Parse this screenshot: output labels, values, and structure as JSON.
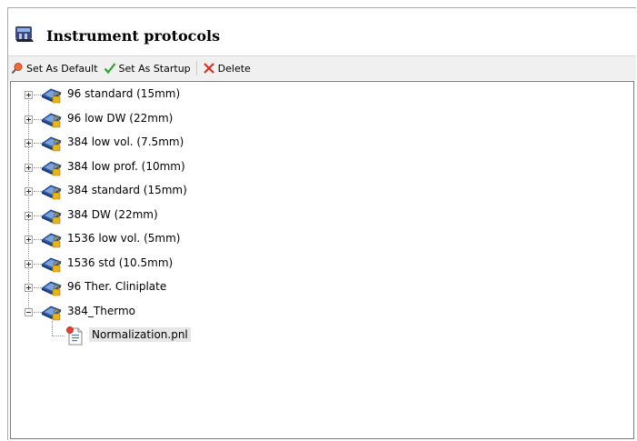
{
  "header": {
    "title": "Instrument protocols",
    "icon": "instrument-icon"
  },
  "toolbar": {
    "set_default": "Set As Default",
    "set_startup": "Set As Startup",
    "delete": "Delete"
  },
  "tree": {
    "items": [
      {
        "label": "96 standard (15mm)",
        "expanded": false
      },
      {
        "label": "96 low DW (22mm)",
        "expanded": false
      },
      {
        "label": "384 low vol. (7.5mm)",
        "expanded": false
      },
      {
        "label": "384 low prof. (10mm)",
        "expanded": false
      },
      {
        "label": "384 standard (15mm)",
        "expanded": false
      },
      {
        "label": "384 DW (22mm)",
        "expanded": false
      },
      {
        "label": "1536 low vol. (5mm)",
        "expanded": false
      },
      {
        "label": "1536 std (10.5mm)",
        "expanded": false
      },
      {
        "label": "96 Ther. Cliniplate",
        "expanded": false
      },
      {
        "label": "384_Thermo",
        "expanded": true
      }
    ],
    "child": {
      "label": "Normalization.pnl",
      "selected": true
    }
  }
}
